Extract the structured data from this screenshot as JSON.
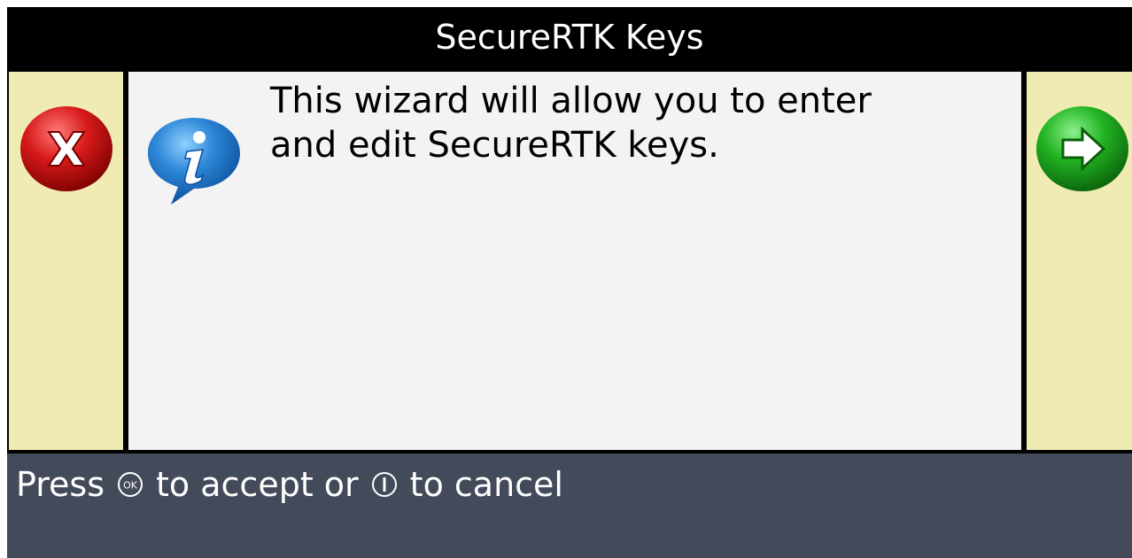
{
  "dialog": {
    "title": "SecureRTK Keys",
    "message_line1": "This wizard will allow you to enter",
    "message_line2": "and edit SecureRTK keys."
  },
  "buttons": {
    "cancel_icon": "close-x-icon",
    "next_icon": "arrow-right-icon",
    "info_icon": "info-bubble-icon"
  },
  "footer": {
    "prefix": "Press",
    "ok_key_label": "OK",
    "middle": "to accept or",
    "power_key_icon": "power-key-icon",
    "suffix": "to cancel"
  },
  "colors": {
    "title_bg": "#000000",
    "side_panel": "#f0ebb3",
    "content_bg": "#f3f3f3",
    "footer_bg": "#434a5a",
    "cancel_red": "#d71a1a",
    "next_green": "#22b322",
    "info_blue": "#2e87d8"
  }
}
